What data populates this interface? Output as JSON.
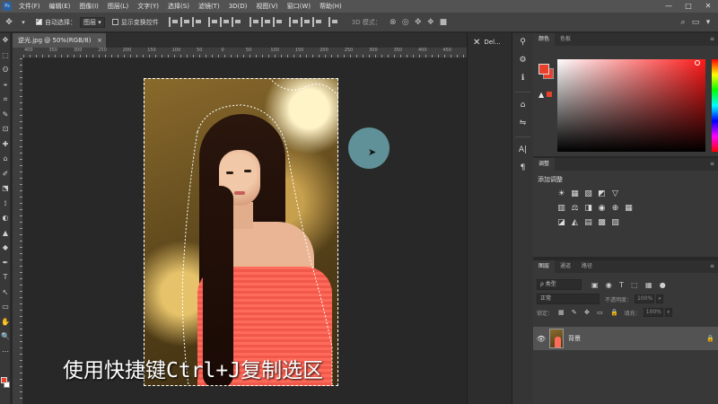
{
  "app": {
    "logo_text": "Ps",
    "menu": [
      "文件(F)",
      "编辑(E)",
      "图像(I)",
      "图层(L)",
      "文字(Y)",
      "选择(S)",
      "滤镜(T)",
      "3D(D)",
      "视图(V)",
      "窗口(W)",
      "帮助(H)"
    ],
    "window_controls": {
      "minimize": "—",
      "maximize": "□",
      "close": "✕"
    }
  },
  "options": {
    "tool_icon": "✥",
    "tool_dropdown": "▾",
    "auto_select_label": "自动选择：",
    "auto_select_checked": true,
    "auto_select_target": "图层",
    "show_transform_label": "显示变换控件",
    "show_transform_checked": false,
    "mode_3d_label": "3D 模式：",
    "icons_3d": [
      "⊗",
      "◎",
      "✥",
      "❖",
      "■"
    ],
    "right_icons": [
      "⌕",
      "▭",
      "▾"
    ]
  },
  "document": {
    "tab_title": "逆光.jpg @ 50%(RGB/8)",
    "tab_close": "×",
    "ruler_numbers": [
      "400",
      "350",
      "300",
      "250",
      "200",
      "150",
      "100",
      "50",
      "0",
      "50",
      "100",
      "150",
      "200",
      "250",
      "300",
      "350",
      "400",
      "450"
    ],
    "caption": "使用快捷键Ctrl+J复制选区"
  },
  "tools": [
    "✥",
    "⬚",
    "ʘ",
    "⌖",
    "⌗",
    "✎",
    "⊡",
    "✚",
    "⌂",
    "✐",
    "⬔",
    "⟟",
    "◐",
    "▲",
    "◆",
    "✒",
    "T",
    "↖",
    "▭",
    "✋",
    "🔍",
    "⋯"
  ],
  "mid_panel": {
    "items": [
      {
        "icon": "✕",
        "label": "Del..."
      }
    ]
  },
  "icon_column": [
    "⚲",
    "⚙",
    "ℹ",
    "⌂",
    "⇋",
    "A|",
    "¶"
  ],
  "color_panel": {
    "tabs": [
      "颜色",
      "色板"
    ],
    "menu_icon": "≡",
    "gamut_warning": "▲",
    "fg_color": "#e8402a",
    "bg_color": "#e8402a"
  },
  "adjustments_panel": {
    "tabs": [
      "调整"
    ],
    "menu_icon": "≡",
    "title": "添加调整",
    "row1": [
      "☀",
      "▦",
      "▧",
      "◩",
      "▽"
    ],
    "row2": [
      "▥",
      "⚖",
      "◨",
      "◉",
      "⊕",
      "▦"
    ],
    "row3": [
      "◪",
      "◭",
      "▤",
      "▩",
      "▨"
    ]
  },
  "layers_panel": {
    "tabs": [
      "图层",
      "通道",
      "路径"
    ],
    "menu_icon": "≡",
    "filter_label": "ρ 类型",
    "filter_icons": [
      "▣",
      "◉",
      "T",
      "⬚",
      "▦",
      "●"
    ],
    "blend_mode": "正常",
    "opacity_label": "不透明度：",
    "opacity_value": "100%",
    "lock_label": "锁定：",
    "lock_icons": [
      "▦",
      "✎",
      "✥",
      "▭",
      "🔒"
    ],
    "fill_label": "填充：",
    "fill_value": "100%",
    "layers": [
      {
        "name": "背景",
        "visible_icon": "👁",
        "lock_icon": "🔒"
      }
    ]
  }
}
